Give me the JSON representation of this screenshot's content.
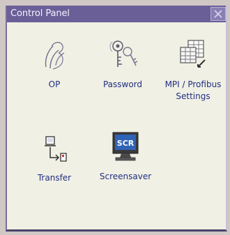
{
  "window": {
    "title": "Control Panel"
  },
  "items": [
    {
      "label": "OP",
      "icon": "op-touch-icon"
    },
    {
      "label": "Password",
      "icon": "password-keys-icon"
    },
    {
      "label": "MPI / Profibus Settings",
      "icon": "network-settings-icon"
    },
    {
      "label": "Transfer",
      "icon": "transfer-icon"
    },
    {
      "label": "Screensaver",
      "icon": "screensaver-icon",
      "icon_text": "SCR"
    }
  ],
  "colors": {
    "title_bar": "#6b5f98",
    "background": "#f1f0e4",
    "label_text": "#1e2e82",
    "screensaver_screen": "#2f63b6"
  }
}
